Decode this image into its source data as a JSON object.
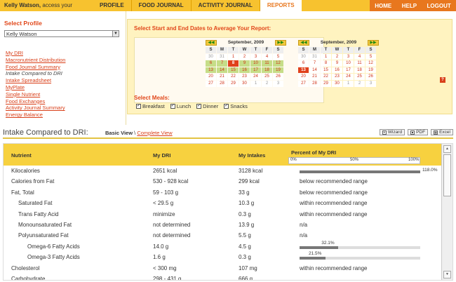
{
  "header": {
    "user_name": "Kelly Watson,",
    "user_suffix": " access your",
    "tabs": [
      {
        "label": "PROFILE"
      },
      {
        "label": "FOOD JOURNAL"
      },
      {
        "label": "ACTIVITY JOURNAL"
      },
      {
        "label": "REPORTS",
        "active": true
      }
    ],
    "util": [
      "HOME",
      "HELP",
      "LOGOUT"
    ]
  },
  "sidebar": {
    "title": "Select Profile",
    "profile": "Kelly Watson",
    "links": [
      "My DRI",
      "Macronutrient Distribution",
      "Food Journal Summary",
      "Intake Compared to DRI",
      "Intake Spreadsheet",
      "MyPlate",
      "Single Nutrient",
      "Food Exchanges",
      "Activity Journal Summary",
      "Energy Balance"
    ],
    "current_index": 3
  },
  "dates": {
    "title": "Select Start and End Dates to Average Your Report:",
    "weekdays": [
      "S",
      "M",
      "T",
      "W",
      "T",
      "F",
      "S"
    ],
    "calendars": [
      {
        "month": "September, 2009",
        "days": [
          [
            "30",
            "31",
            "1",
            "2",
            "3",
            "4",
            "5"
          ],
          [
            "6",
            "7",
            "8",
            "9",
            "10",
            "11",
            "12"
          ],
          [
            "13",
            "14",
            "15",
            "16",
            "17",
            "18",
            "19"
          ],
          [
            "20",
            "21",
            "22",
            "23",
            "24",
            "25",
            "26"
          ],
          [
            "27",
            "28",
            "29",
            "30",
            "1",
            "2",
            "3"
          ]
        ]
      },
      {
        "month": "September, 2009",
        "days": [
          [
            "30",
            "31",
            "1",
            "2",
            "3",
            "4",
            "5"
          ],
          [
            "6",
            "7",
            "8",
            "9",
            "10",
            "11",
            "12"
          ],
          [
            "13",
            "14",
            "15",
            "16",
            "17",
            "18",
            "19"
          ],
          [
            "20",
            "21",
            "22",
            "23",
            "24",
            "25",
            "26"
          ],
          [
            "27",
            "28",
            "29",
            "30",
            "1",
            "2",
            "3"
          ]
        ]
      }
    ],
    "prev_label": "◀◀",
    "next_label": "▶▶",
    "help_label": "?"
  },
  "meals": {
    "title": "Select Meals:",
    "items": [
      {
        "label": "Breakfast",
        "checked": true
      },
      {
        "label": "Lunch",
        "checked": true
      },
      {
        "label": "Dinner",
        "checked": true
      },
      {
        "label": "Snacks",
        "checked": true
      }
    ]
  },
  "report": {
    "title": "Intake Compared to DRI:",
    "view_basic": "Basic View",
    "view_sep": " \\ ",
    "view_complete": "Complete View",
    "buttons": [
      "Wizard",
      "PDF",
      "Excel"
    ],
    "columns": [
      "Nutrient",
      "My DRI",
      "My Intakes",
      "Percent of My DRI"
    ],
    "axis": [
      "0%",
      "50%",
      "100%"
    ],
    "rows": [
      {
        "indent": 0,
        "nutrient": "Kilocalories",
        "dri": "2651 kcal",
        "intake": "3128 kcal",
        "percent": 118.0,
        "percent_label": "118.0%"
      },
      {
        "indent": 0,
        "nutrient": "Calories from Fat",
        "dri": "530 - 928 kcal",
        "intake": "299 kcal",
        "status": "below recommended range"
      },
      {
        "indent": 0,
        "nutrient": "Fat, Total",
        "dri": "59 - 103 g",
        "intake": "33 g",
        "status": "below recommended range"
      },
      {
        "indent": 1,
        "nutrient": "Saturated Fat",
        "dri": "< 29.5 g",
        "intake": "10.3 g",
        "status": "within recommended range"
      },
      {
        "indent": 1,
        "nutrient": "Trans Fatty Acid",
        "dri": "minimize",
        "intake": "0.3 g",
        "status": "within recommended range"
      },
      {
        "indent": 1,
        "nutrient": "Monounsaturated Fat",
        "dri": "not determined",
        "intake": "13.9 g",
        "status": "n/a"
      },
      {
        "indent": 1,
        "nutrient": "Polyunsaturated Fat",
        "dri": "not determined",
        "intake": "5.5 g",
        "status": "n/a"
      },
      {
        "indent": 2,
        "nutrient": "Omega-6 Fatty Acids",
        "dri": "14.0 g",
        "intake": "4.5 g",
        "percent": 32.1,
        "percent_label": "32.1%"
      },
      {
        "indent": 2,
        "nutrient": "Omega-3 Fatty Acids",
        "dri": "1.6 g",
        "intake": "0.3 g",
        "percent": 21.5,
        "percent_label": "21.5%"
      },
      {
        "indent": 0,
        "nutrient": "Cholesterol",
        "dri": "< 300 mg",
        "intake": "107 mg",
        "status": "within recommended range"
      },
      {
        "indent": 0,
        "nutrient": "Carbohydrate",
        "dri": "298 - 431 g",
        "intake": "666 g",
        "status": ""
      }
    ]
  },
  "colors": {
    "accent": "#e8771e",
    "brand": "#f7c22f",
    "link": "#d9401a"
  }
}
